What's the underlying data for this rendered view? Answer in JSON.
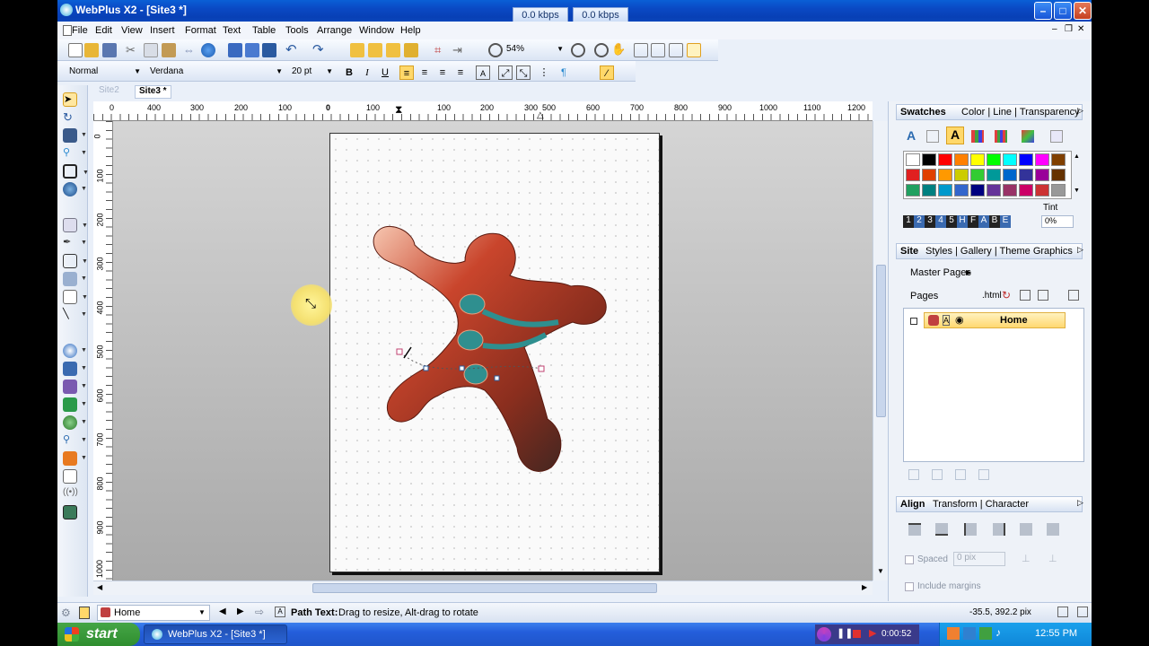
{
  "window": {
    "title": "WebPlus X2 - [Site3 *]",
    "net_down": "0.0 kbps",
    "net_up": "0.0 kbps",
    "minimize": "–",
    "maximize": "□",
    "close": "✕"
  },
  "menu": [
    "File",
    "Edit",
    "View",
    "Insert",
    "Format",
    "Text",
    "Table",
    "Tools",
    "Arrange",
    "Window",
    "Help"
  ],
  "toolbar": {
    "zoom": "54%"
  },
  "format": {
    "style": "Normal",
    "font": "Verdana",
    "size": "20 pt",
    "bold": "B",
    "italic": "I",
    "underline": "U"
  },
  "tabs": [
    "Site2",
    "Site3 *"
  ],
  "ruler": {
    "h_labels": [
      "0",
      "400",
      "300",
      "200",
      "100",
      "0",
      "100",
      "100",
      "200",
      "300",
      "500",
      "600",
      "700",
      "800",
      "900",
      "1000",
      "1100",
      "1200"
    ],
    "v_labels": [
      "0",
      "100",
      "200",
      "300",
      "400",
      "500",
      "600",
      "700",
      "800",
      "900",
      "1000"
    ]
  },
  "studio": {
    "swatches_tabs": {
      "active": "Swatches",
      "rest": "Color | Line | Transparency"
    },
    "tint_label": "Tint",
    "tint_value": "0%",
    "swatch_colors": [
      [
        "#ffffff",
        "#000000",
        "#ff0000",
        "#ff8000",
        "#ffff00",
        "#00ff00",
        "#00ffff",
        "#0000ff",
        "#ff00ff",
        "#804000"
      ],
      [
        "#e02020",
        "#e04000",
        "#ff9900",
        "#cccc00",
        "#33cc33",
        "#009999",
        "#0066cc",
        "#333399",
        "#990099",
        "#663300"
      ],
      [
        "#20a060",
        "#008080",
        "#0099cc",
        "#3366cc",
        "#000080",
        "#663399",
        "#993366",
        "#cc0066",
        "#cc3333",
        "#999999"
      ]
    ],
    "palette_digits": [
      "1",
      "2",
      "3",
      "4",
      "5",
      "H",
      "F",
      "A",
      "B",
      "E"
    ],
    "site_tabs": {
      "active": "Site",
      "rest": "Styles | Gallery | Theme Graphics"
    },
    "master_pages": "Master Pages",
    "pages_label": "Pages",
    "html_label": ".html",
    "home_page": "Home",
    "align_tabs": {
      "active": "Align",
      "rest": "Transform | Character"
    },
    "spaced_label": "Spaced",
    "spaced_value": "0 pix",
    "include_margins": "Include margins"
  },
  "status": {
    "page_select": "Home",
    "hint_bold": "Path Text:",
    "hint": "Drag to resize, Alt-drag to rotate",
    "coords": "-35.5, 392.2 pix"
  },
  "taskbar": {
    "start": "start",
    "task": "WebPlus X2 - [Site3 *]",
    "recorder_time": "0:00:52",
    "clock": "12:55 PM"
  },
  "colors": {
    "title_blue": "#0a49c4",
    "shape_red": "#c9452c",
    "shape_dark": "#2a2321",
    "shape_teal": "#2f8f8f",
    "start_green": "#3a9a3a"
  }
}
